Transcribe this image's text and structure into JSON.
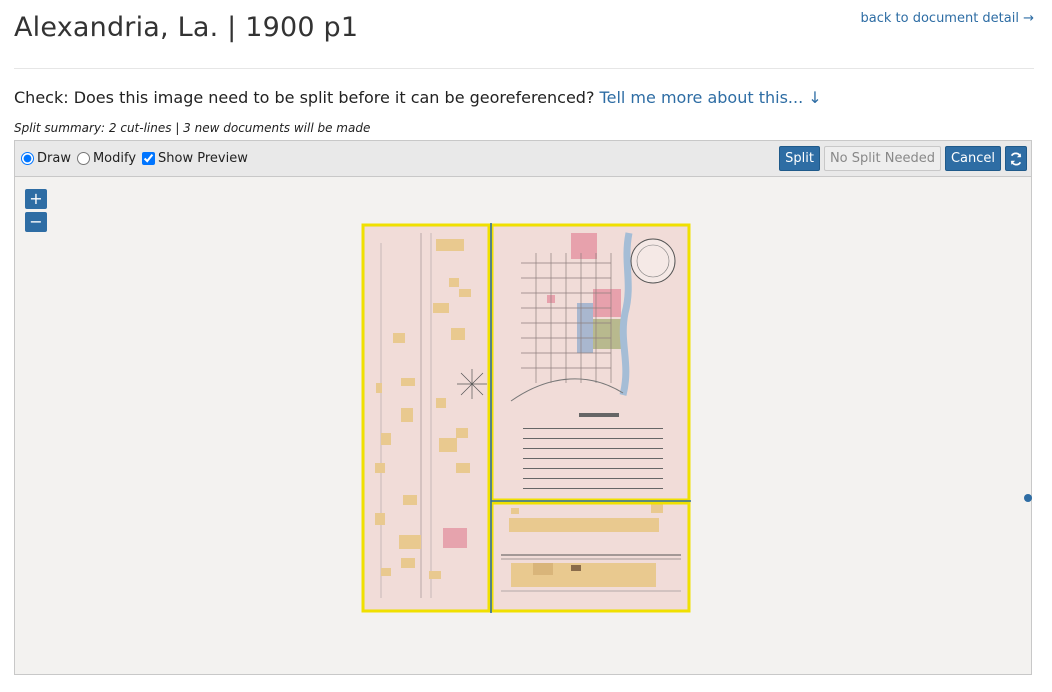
{
  "page": {
    "title": "Alexandria, La. | 1900 p1",
    "back_link": "back to document detail →"
  },
  "check": {
    "question": "Check: Does this image need to be split before it can be georeferenced?",
    "more_link": "Tell me more about this... ↓"
  },
  "summary": "Split summary: 2 cut-lines | 3 new documents will be made",
  "toolbar": {
    "draw_label": "Draw",
    "modify_label": "Modify",
    "preview_label": "Show Preview",
    "draw_selected": true,
    "preview_checked": true,
    "split_label": "Split",
    "no_split_label": "No Split Needed",
    "cancel_label": "Cancel",
    "refresh_icon": "refresh-icon"
  },
  "map": {
    "zoom_in": "+",
    "zoom_out": "−",
    "split_line_color": "#2e6da4",
    "preview_outline_color": "#f0e000"
  }
}
